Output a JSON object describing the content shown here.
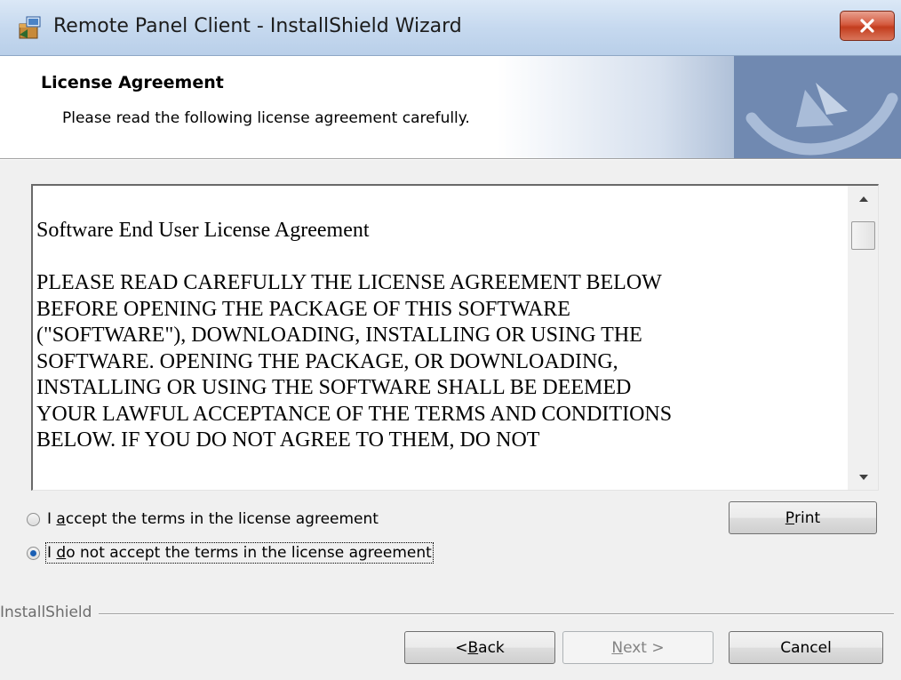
{
  "window": {
    "title": "Remote Panel Client - InstallShield Wizard"
  },
  "header": {
    "title": "License Agreement",
    "subtitle": "Please read the following license agreement carefully."
  },
  "license": {
    "heading": "Software End User License Agreement",
    "lines": [
      "PLEASE READ CAREFULLY THE LICENSE AGREEMENT BELOW",
      "BEFORE OPENING THE PACKAGE OF THIS SOFTWARE",
      "(\"SOFTWARE\"), DOWNLOADING, INSTALLING OR USING THE",
      "SOFTWARE. OPENING THE PACKAGE, OR DOWNLOADING,",
      "INSTALLING OR USING THE SOFTWARE SHALL BE DEEMED",
      "YOUR LAWFUL ACCEPTANCE OF THE TERMS AND CONDITIONS",
      "BELOW. IF YOU DO NOT AGREE TO THEM, DO NOT"
    ]
  },
  "options": {
    "accept": {
      "pre": "I ",
      "mnemonic": "a",
      "post": "ccept the terms in the license agreement",
      "selected": false
    },
    "decline": {
      "pre": "I ",
      "mnemonic": "d",
      "post": "o not accept the terms in the license agreement",
      "selected": true
    }
  },
  "buttons": {
    "print": {
      "mnemonic": "P",
      "rest": "rint"
    },
    "back": {
      "pre": "< ",
      "mnemonic": "B",
      "rest": "ack"
    },
    "next": {
      "mnemonic": "N",
      "rest": "ext >",
      "enabled": false
    },
    "cancel": "Cancel"
  },
  "footer": {
    "brand": "InstallShield"
  },
  "colors": {
    "close_button": "#c9462a",
    "radio_selected": "#1a5fb4",
    "banner_dark": "#6883ac"
  },
  "icons": {
    "app": "installer-icon",
    "close": "close-icon",
    "logo": "installshield-logo-icon",
    "scroll_up": "scroll-up-arrow-icon",
    "scroll_down": "scroll-down-arrow-icon"
  }
}
